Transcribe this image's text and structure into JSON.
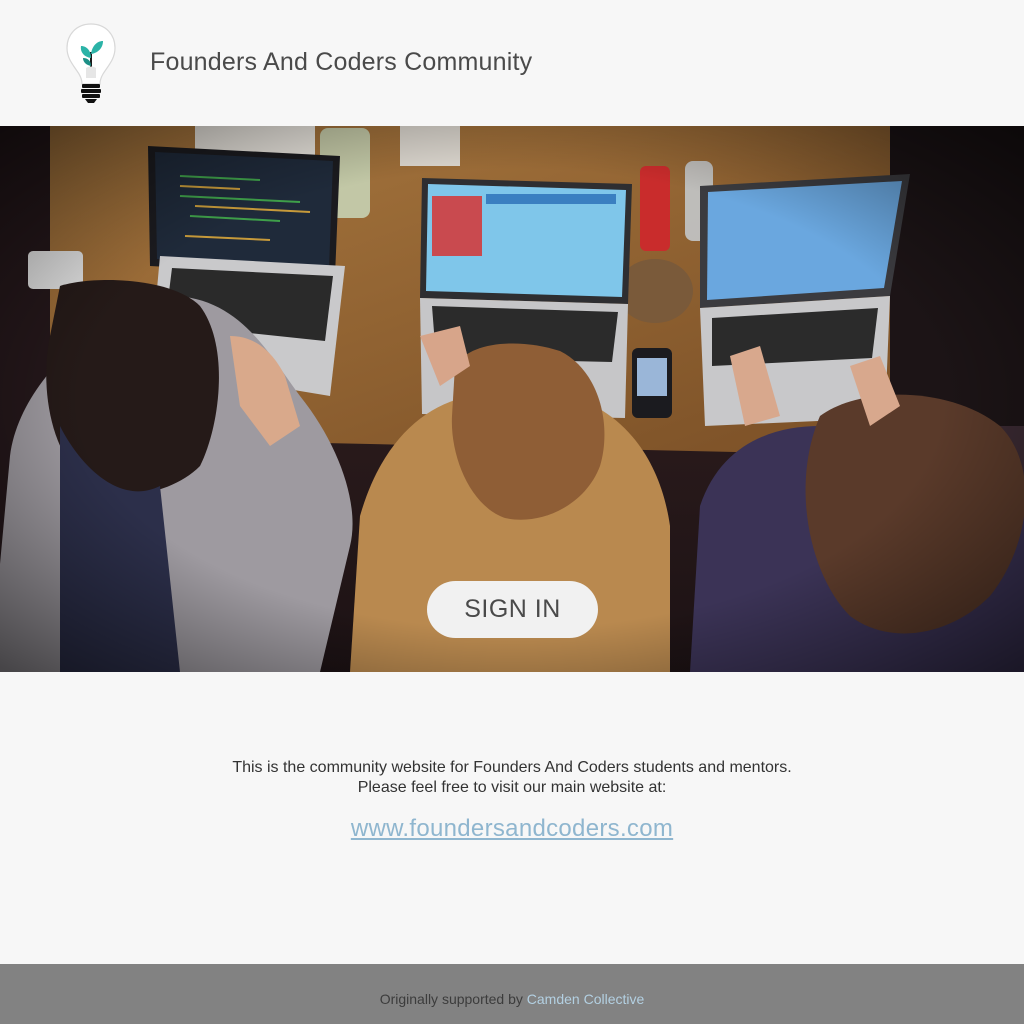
{
  "header": {
    "title": "Founders And Coders Community",
    "logo_icon": "lightbulb-plant-icon"
  },
  "hero": {
    "image_description": "four-people-coding-on-laptops",
    "signin_label": "SIGN IN"
  },
  "info": {
    "line1": "This is the community website for Founders And Coders students and mentors.",
    "line2": "Please feel free to visit our main website at:",
    "link_text": "www.foundersandcoders.com"
  },
  "footer": {
    "prefix": "Originally supported by",
    "link_text": "Camden Collective"
  },
  "colors": {
    "background": "#f7f7f7",
    "link": "#8fb6cf",
    "footer_bg": "#828282",
    "footer_link": "#b3d0e2",
    "button_bg": "#f1f1f1"
  }
}
